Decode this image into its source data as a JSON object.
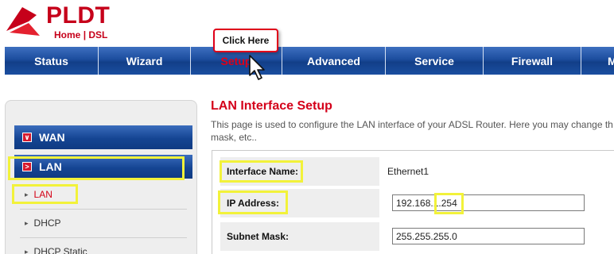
{
  "header": {
    "logo_text": "PLDT",
    "logo_sub_left": "Home",
    "logo_sub_sep": "|",
    "logo_sub_right": "DSL"
  },
  "nav": {
    "items": [
      {
        "label": "Status"
      },
      {
        "label": "Wizard"
      },
      {
        "label": "Setup",
        "active": true
      },
      {
        "label": "Advanced"
      },
      {
        "label": "Service"
      },
      {
        "label": "Firewall"
      },
      {
        "label": "M"
      }
    ]
  },
  "callout": {
    "text": "Click Here"
  },
  "sidebar": {
    "wan_label": "WAN",
    "lan_label": "LAN",
    "sub_items": [
      {
        "label": "LAN",
        "active": true
      },
      {
        "label": "DHCP"
      },
      {
        "label": "DHCP Static"
      }
    ]
  },
  "main": {
    "title": "LAN Interface Setup",
    "description": "This page is used to configure the LAN interface of your ADSL Router. Here you may change th mask, etc..",
    "fields": {
      "interface_name_label": "Interface Name:",
      "interface_name_value": "Ethernet1",
      "ip_label": "IP Address:",
      "ip_value": "192.168.1.254",
      "mask_label": "Subnet Mask:",
      "mask_value": "255.255.255.0"
    }
  },
  "colors": {
    "brand_red": "#c6001a",
    "nav_blue": "#1c4d9e",
    "highlight_yellow": "#f2f23a"
  }
}
